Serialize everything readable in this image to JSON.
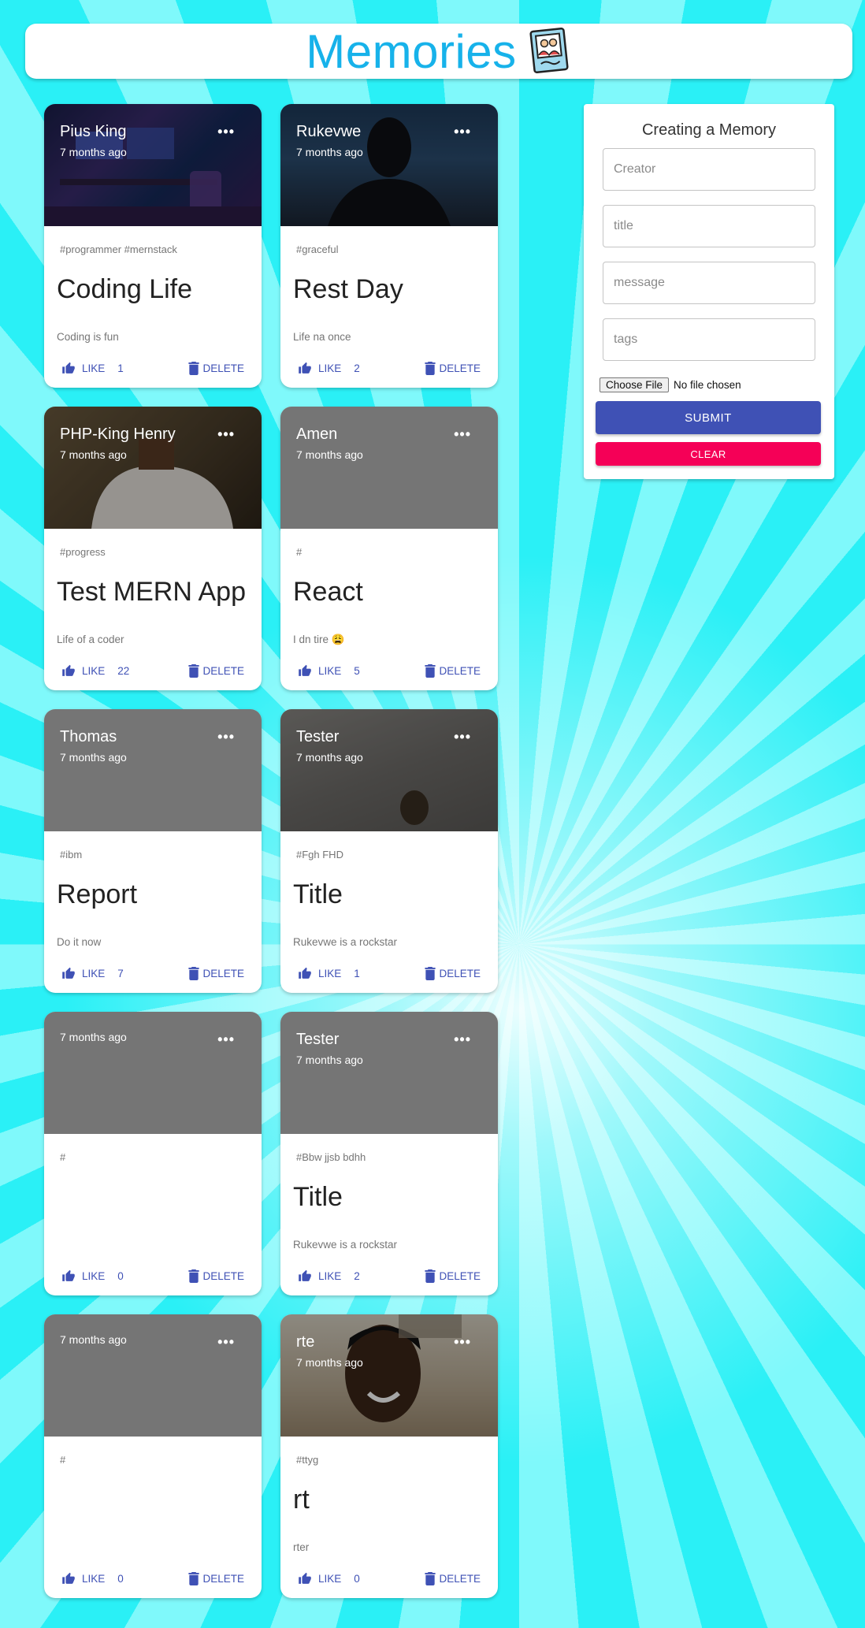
{
  "header": {
    "title": "Memories",
    "logo_icon": "photo-memory-icon"
  },
  "colors": {
    "accent": "#3f51b5",
    "brand_title": "#17b2ea",
    "clear": "#f50057",
    "media_placeholder": "#7a7a7a"
  },
  "posts": [
    {
      "creator": "Pius King",
      "time": "7 months ago",
      "tags": "#programmer #mernstack",
      "title": "Coding Life",
      "message": "Coding is fun",
      "like_label": "LIKE",
      "likes": "1",
      "delete_label": "DELETE",
      "media": "photo"
    },
    {
      "creator": "Rukevwe",
      "time": "7 months ago",
      "tags": "#graceful",
      "title": "Rest Day",
      "message": "Life na once",
      "like_label": "LIKE",
      "likes": "2",
      "delete_label": "DELETE",
      "media": "photo"
    },
    {
      "creator": "PHP-King Henry",
      "time": "7 months ago",
      "tags": "#progress",
      "title": "Test MERN App",
      "message": "Life of a coder",
      "like_label": "LIKE",
      "likes": "22",
      "delete_label": "DELETE",
      "media": "photo"
    },
    {
      "creator": "Amen",
      "time": "7 months ago",
      "tags": "#",
      "title": "React",
      "message": "I dn tire 😩",
      "like_label": "LIKE",
      "likes": "5",
      "delete_label": "DELETE",
      "media": "none"
    },
    {
      "creator": "Thomas",
      "time": "7 months ago",
      "tags": "#ibm",
      "title": "Report",
      "message": "Do it now",
      "like_label": "LIKE",
      "likes": "7",
      "delete_label": "DELETE",
      "media": "none"
    },
    {
      "creator": "Tester",
      "time": "7 months ago",
      "tags": "#Fgh FHD",
      "title": "Title",
      "message": "Rukevwe is a rockstar",
      "like_label": "LIKE",
      "likes": "1",
      "delete_label": "DELETE",
      "media": "photo"
    },
    {
      "creator": "",
      "time": "7 months ago",
      "tags": "#",
      "title": "",
      "message": "",
      "like_label": "LIKE",
      "likes": "0",
      "delete_label": "DELETE",
      "media": "none"
    },
    {
      "creator": "Tester",
      "time": "7 months ago",
      "tags": "#Bbw jjsb bdhh",
      "title": "Title",
      "message": "Rukevwe is a rockstar",
      "like_label": "LIKE",
      "likes": "2",
      "delete_label": "DELETE",
      "media": "none"
    },
    {
      "creator": "",
      "time": "7 months ago",
      "tags": "#",
      "title": "",
      "message": "",
      "like_label": "LIKE",
      "likes": "0",
      "delete_label": "DELETE",
      "media": "none"
    },
    {
      "creator": "rte",
      "time": "7 months ago",
      "tags": "#ttyg",
      "title": "rt",
      "message": "rter",
      "like_label": "LIKE",
      "likes": "0",
      "delete_label": "DELETE",
      "media": "photo"
    }
  ],
  "form": {
    "title": "Creating a Memory",
    "creator_placeholder": "Creator",
    "title_placeholder": "title",
    "message_placeholder": "message",
    "tags_placeholder": "tags",
    "file_button": "Choose File",
    "file_status": "No file chosen",
    "submit_label": "SUBMIT",
    "clear_label": "CLEAR"
  }
}
